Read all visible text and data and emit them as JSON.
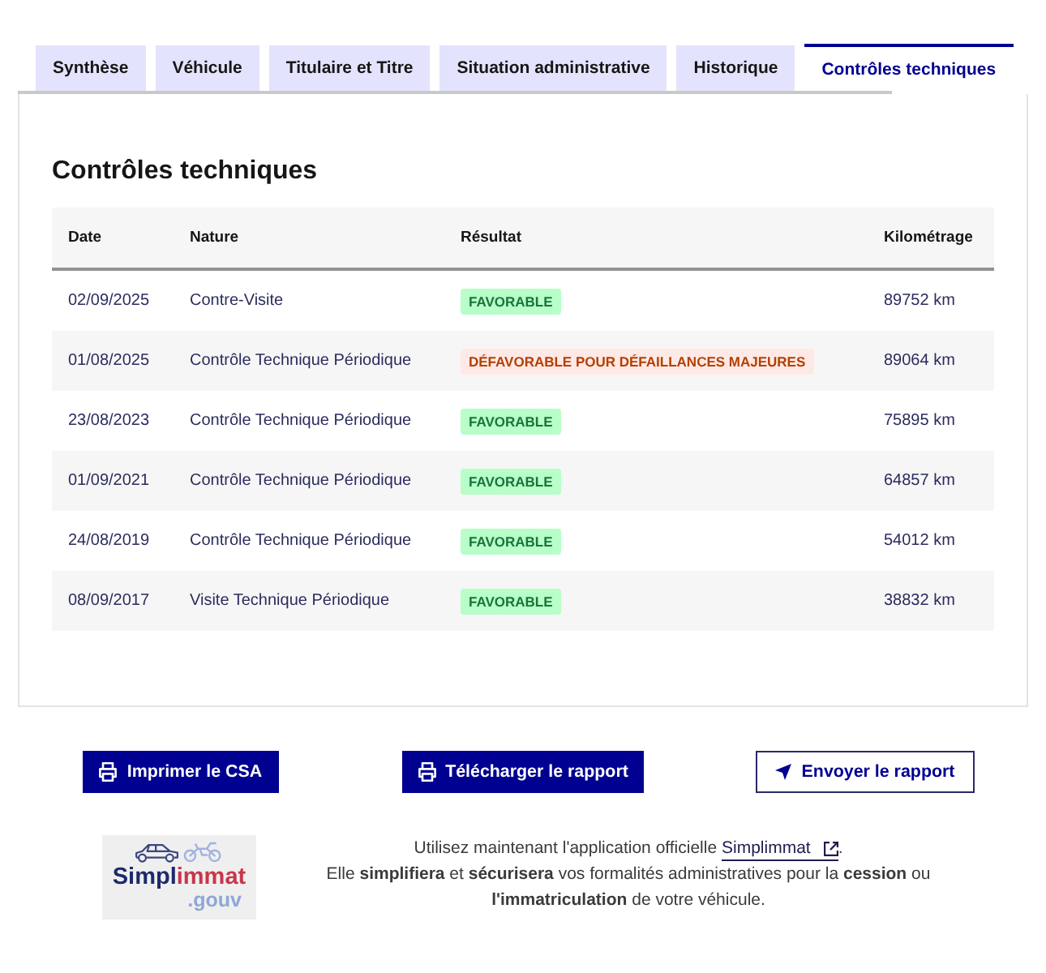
{
  "tabs": [
    {
      "label": "Synthèse",
      "selected": false
    },
    {
      "label": "Véhicule",
      "selected": false
    },
    {
      "label": "Titulaire et Titre",
      "selected": false
    },
    {
      "label": "Situation administrative",
      "selected": false
    },
    {
      "label": "Historique",
      "selected": false
    },
    {
      "label": "Contrôles techniques",
      "selected": true
    }
  ],
  "panel": {
    "title": "Contrôles techniques",
    "table": {
      "columns": [
        "Date",
        "Nature",
        "Résultat",
        "Kilométrage"
      ],
      "rows": [
        {
          "date": "02/09/2025",
          "nature": "Contre-Visite",
          "result": {
            "text": "FAVORABLE",
            "kind": "success"
          },
          "mileage": "89752 km"
        },
        {
          "date": "01/08/2025",
          "nature": "Contrôle Technique Périodique",
          "result": {
            "text": "DÉFAVORABLE POUR DÉFAILLANCES MAJEURES",
            "kind": "error"
          },
          "mileage": "89064 km"
        },
        {
          "date": "23/08/2023",
          "nature": "Contrôle Technique Périodique",
          "result": {
            "text": "FAVORABLE",
            "kind": "success"
          },
          "mileage": "75895 km"
        },
        {
          "date": "01/09/2021",
          "nature": "Contrôle Technique Périodique",
          "result": {
            "text": "FAVORABLE",
            "kind": "success"
          },
          "mileage": "64857 km"
        },
        {
          "date": "24/08/2019",
          "nature": "Contrôle Technique Périodique",
          "result": {
            "text": "FAVORABLE",
            "kind": "success"
          },
          "mileage": "54012 km"
        },
        {
          "date": "08/09/2017",
          "nature": "Visite Technique Périodique",
          "result": {
            "text": "FAVORABLE",
            "kind": "success"
          },
          "mileage": "38832 km"
        }
      ]
    }
  },
  "buttons": [
    {
      "label": "Imprimer le CSA",
      "kind": "primary"
    },
    {
      "label": "Télécharger le rapport",
      "kind": "primary"
    },
    {
      "label": "Envoyer le rapport",
      "kind": "secondary"
    }
  ],
  "promo": {
    "logo": {
      "wordmark": [
        "Simpl",
        "immat"
      ],
      "suffix": ".gouv"
    },
    "intro_before": "Utilisez maintenant l'application officielle",
    "link": "Simplimmat",
    "intro_after": ".",
    "body": "Elle **simplifiera** et **sécurisera** vos formalités administratives pour la **cession** ou **l'immatriculation** de votre véhicule."
  }
}
